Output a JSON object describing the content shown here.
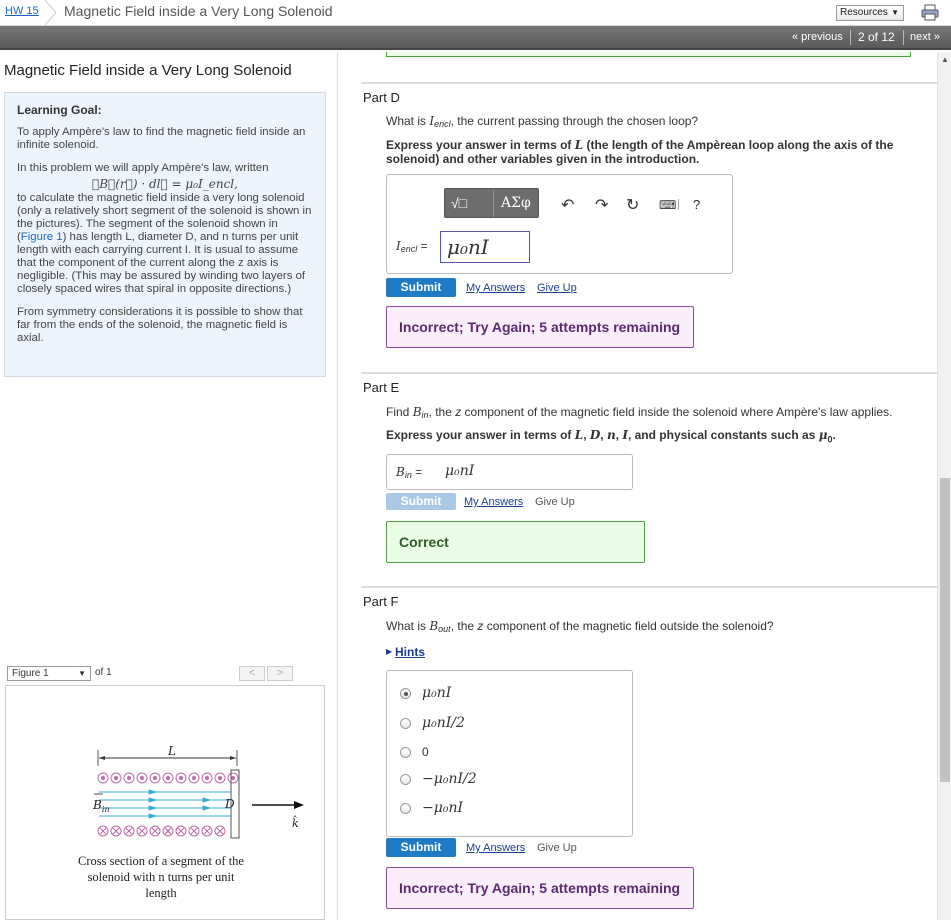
{
  "topbar": {
    "hw_link": "HW 15",
    "assignment_title": "Magnetic Field inside a Very Long Solenoid",
    "resources_label": "Resources"
  },
  "nav": {
    "previous": "« previous",
    "position": "2 of 12",
    "next": "next »"
  },
  "left": {
    "problem_title": "Magnetic Field inside a Very Long Solenoid",
    "learning_goal": {
      "heading": "Learning Goal:",
      "goal": "To apply Ampère's law to find the magnetic field inside an infinite solenoid.",
      "intro": "In this problem we will apply Ampère's law, written",
      "equation": "∮B⃗(r⃗) · dl⃗ = μ₀I_encl,",
      "p2_before_link": "to calculate the magnetic field inside a very long solenoid (only a relatively short segment of the solenoid is shown in the pictures). The segment of the solenoid shown in (",
      "figure_link": "Figure 1",
      "p2_after_link": ") has length L, diameter D, and n turns per unit length with each carrying current I. It is usual to assume that the component of the current along the z axis is negligible. (This may be assured by winding two layers of closely spaced wires that spiral in opposite directions.)",
      "p3": "From symmetry considerations it is possible to show that far from the ends of the solenoid, the magnetic field is axial."
    },
    "figure": {
      "select_label": "Figure 1",
      "of_label": "of 1",
      "labels": {
        "L": "L",
        "D": "D",
        "Bin": "B",
        "Bin_sub": "in",
        "k": "k̂"
      },
      "caption": "Cross section of a segment of the solenoid with n turns per unit length"
    }
  },
  "partD": {
    "label": "Part D",
    "question": "What is I_encl, the current passing through the chosen loop?",
    "instruction": "Express your answer in terms of L (the length of the Ampèrean loop along the axis of the solenoid) and other variables given in the introduction.",
    "toolbar": {
      "templates": "√□",
      "greek": "ΑΣφ",
      "help": "?"
    },
    "answer_label": "I_encl =",
    "answer_value": "μ₀nI",
    "submit": "Submit",
    "my_answers": "My Answers",
    "give_up": "Give Up",
    "feedback": "Incorrect; Try Again; 5 attempts remaining"
  },
  "partE": {
    "label": "Part E",
    "question": "Find B_in, the z component of the magnetic field inside the solenoid where Ampère's law applies.",
    "instruction": "Express your answer in terms of L, D, n, I, and physical constants such as μ₀.",
    "answer_label": "B_in =",
    "answer_value": "μ₀nI",
    "submit": "Submit",
    "my_answers": "My Answers",
    "give_up": "Give Up",
    "feedback": "Correct"
  },
  "partF": {
    "label": "Part F",
    "question": "What is B_out, the z component of the magnetic field outside the solenoid?",
    "hints": "Hints",
    "choices": [
      "μ₀nI",
      "μ₀nI/2",
      "0",
      "−μ₀nI/2",
      "−μ₀nI"
    ],
    "selected_index": 0,
    "submit": "Submit",
    "my_answers": "My Answers",
    "give_up": "Give Up",
    "feedback": "Incorrect; Try Again; 5 attempts remaining"
  },
  "colors": {
    "accent_blue": "#1f7cc4",
    "incorrect_border": "#8c4b9e",
    "correct_border": "#4e9f3d",
    "navbar": "#666666",
    "current_dot": "#d070b8",
    "field_arrow": "#3aaed0"
  }
}
